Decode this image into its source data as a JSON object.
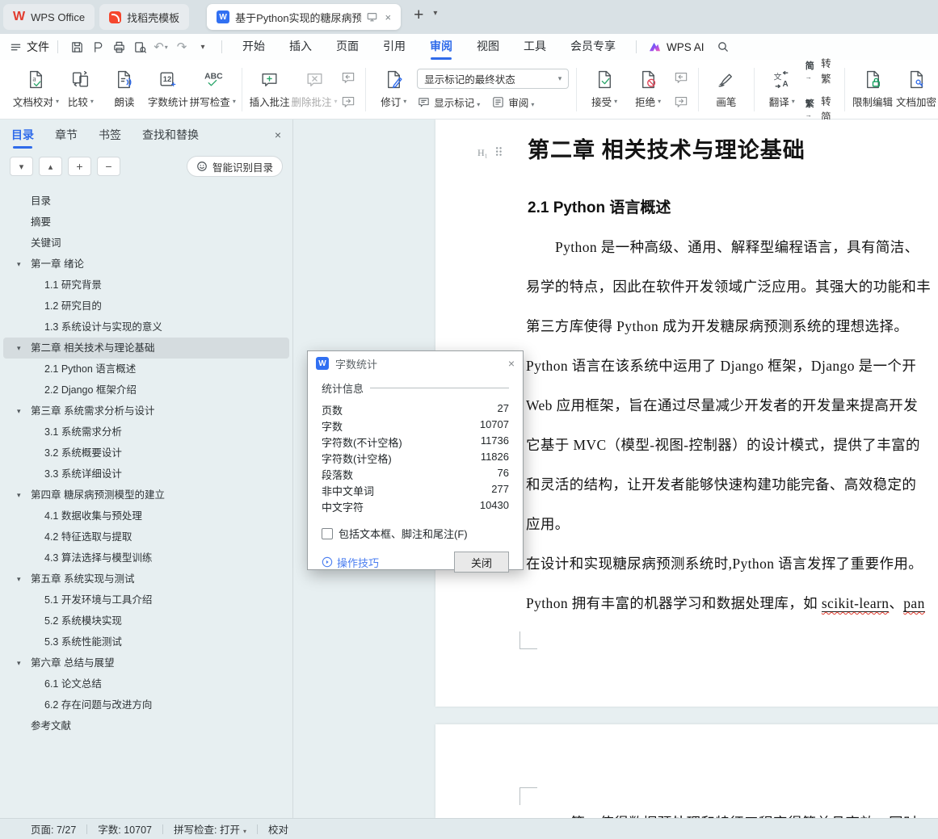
{
  "tabbar": {
    "tabs": [
      {
        "label": "WPS Office"
      },
      {
        "label": "找稻壳模板"
      },
      {
        "label": "基于Python实现的糖尿病预测",
        "active": true
      }
    ]
  },
  "menubar": {
    "file": "文件",
    "items": [
      "开始",
      "插入",
      "页面",
      "引用",
      "审阅",
      "视图",
      "工具",
      "会员专享"
    ],
    "active_item": "审阅",
    "wps_ai": "WPS AI"
  },
  "ribbon": {
    "doc_proof": "文档校对",
    "compare": "比较",
    "read_aloud": "朗读",
    "word_count": "字数统计",
    "spell_check": "拼写检查",
    "insert_comment": "插入批注",
    "delete_comment": "删除批注",
    "track_changes": "修订",
    "markup_state": "显示标记的最终状态",
    "show_markup": "显示标记",
    "review": "审阅",
    "accept": "接受",
    "reject": "拒绝",
    "brush": "画笔",
    "translate": "翻译",
    "simp_char": "简",
    "trad_char": "繁",
    "to_trad": "转繁",
    "to_simp": "转简",
    "restrict_edit": "限制编辑",
    "encrypt": "文档加密"
  },
  "sidebar": {
    "tabs": [
      {
        "label": "目录",
        "active": true
      },
      {
        "label": "章节"
      },
      {
        "label": "书签"
      },
      {
        "label": "查找和替换"
      }
    ],
    "smart_toc": "智能识别目录",
    "toc": [
      {
        "label": "目录",
        "level": 0,
        "arrow": false
      },
      {
        "label": "摘要",
        "level": 0,
        "arrow": false
      },
      {
        "label": "关键词",
        "level": 0,
        "arrow": false
      },
      {
        "label": "第一章 绪论",
        "level": 0,
        "arrow": true
      },
      {
        "label": "1.1 研究背景",
        "level": 1,
        "arrow": false
      },
      {
        "label": "1.2 研究目的",
        "level": 1,
        "arrow": false
      },
      {
        "label": "1.3 系统设计与实现的意义",
        "level": 1,
        "arrow": false
      },
      {
        "label": "第二章 相关技术与理论基础",
        "level": 0,
        "arrow": true,
        "selected": true
      },
      {
        "label": "2.1 Python 语言概述",
        "level": 1,
        "arrow": false
      },
      {
        "label": "2.2 Django 框架介绍",
        "level": 1,
        "arrow": false
      },
      {
        "label": "第三章 系统需求分析与设计",
        "level": 0,
        "arrow": true
      },
      {
        "label": "3.1 系统需求分析",
        "level": 1,
        "arrow": false
      },
      {
        "label": "3.2 系统概要设计",
        "level": 1,
        "arrow": false
      },
      {
        "label": "3.3 系统详细设计",
        "level": 1,
        "arrow": false
      },
      {
        "label": "第四章 糖尿病预测模型的建立",
        "level": 0,
        "arrow": true
      },
      {
        "label": "4.1 数据收集与预处理",
        "level": 1,
        "arrow": false
      },
      {
        "label": "4.2 特征选取与提取",
        "level": 1,
        "arrow": false
      },
      {
        "label": "4.3 算法选择与模型训练",
        "level": 1,
        "arrow": false
      },
      {
        "label": "第五章 系统实现与测试",
        "level": 0,
        "arrow": true
      },
      {
        "label": "5.1 开发环境与工具介绍",
        "level": 1,
        "arrow": false
      },
      {
        "label": "5.2 系统模块实现",
        "level": 1,
        "arrow": false
      },
      {
        "label": "5.3 系统性能测试",
        "level": 1,
        "arrow": false
      },
      {
        "label": "第六章 总结与展望",
        "level": 0,
        "arrow": true
      },
      {
        "label": "6.1 论文总结",
        "level": 1,
        "arrow": false
      },
      {
        "label": "6.2 存在问题与改进方向",
        "level": 1,
        "arrow": false
      },
      {
        "label": "参考文献",
        "level": 0,
        "arrow": false
      }
    ]
  },
  "document": {
    "h1_badge": "H₁",
    "heading": "第二章  相关技术与理论基础",
    "subheading": "2.1 Python 语言概述",
    "lines": [
      {
        "text": "Python 是一种高级、通用、解释型编程语言，具有简洁、",
        "indent": true
      },
      {
        "text": "易学的特点，因此在软件开发领域广泛应用。其强大的功能和丰"
      },
      {
        "text": "第三方库使得 Python 成为开发糖尿病预测系统的理想选择。"
      },
      {
        "text": "Python 语言在该系统中运用了 Django 框架，Django 是一个开"
      },
      {
        "text": "Web 应用框架，旨在通过尽量减少开发者的开发量来提高开发"
      },
      {
        "text": "它基于 MVC（模型-视图-控制器）的设计模式，提供了丰富的"
      },
      {
        "text": "和灵活的结构，让开发者能够快速构建功能完备、高效稳定的"
      },
      {
        "text": "应用。"
      },
      {
        "text": "在设计和实现糖尿病预测系统时,Python 语言发挥了重要作用。"
      }
    ],
    "last_line": {
      "prefix": "Python 拥有丰富的机器学习和数据处理库，如 ",
      "word1": "scikit-learn",
      "mid": "、",
      "word2": "pan"
    },
    "page2_line": "numpy 等，使得数据预处理和特征工程变得简单且高效，同时"
  },
  "dialog": {
    "title": "字数统计",
    "section": "统计信息",
    "rows": [
      {
        "label": "页数",
        "value": "27"
      },
      {
        "label": "字数",
        "value": "10707"
      },
      {
        "label": "字符数(不计空格)",
        "value": "11736"
      },
      {
        "label": "字符数(计空格)",
        "value": "11826"
      },
      {
        "label": "段落数",
        "value": "76"
      },
      {
        "label": "非中文单词",
        "value": "277"
      },
      {
        "label": "中文字符",
        "value": "10430"
      }
    ],
    "checkbox_label": "包括文本框、脚注和尾注(F)",
    "tips_link": "操作技巧",
    "close_button": "关闭"
  },
  "statusbar": {
    "page": "页面: 7/27",
    "words": "字数: 10707",
    "spell": "拼写检查: 打开",
    "proof": "校对"
  }
}
